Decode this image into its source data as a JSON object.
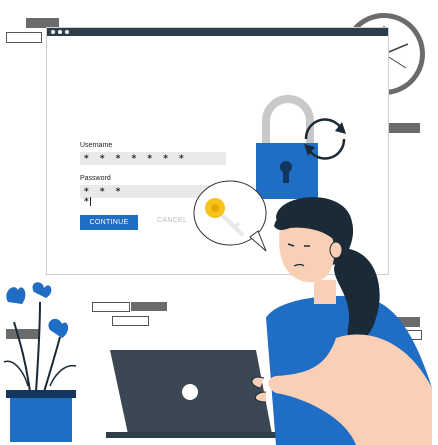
{
  "login": {
    "username_label": "Username",
    "username_value": "* * * * * * *",
    "password_label": "Password",
    "password_value": "* * * *",
    "continue_label": "CONTINUE",
    "cancel_label": "CANCEL"
  },
  "colors": {
    "accent": "#1f6dc4",
    "titlebar": "#2f3d4a",
    "lock": "#1f6dc4",
    "key": "#f7c21a",
    "skin": "#f9d0b5",
    "hair": "#1a2a36",
    "laptop": "#3b4753"
  },
  "icons": [
    "padlock-icon",
    "refresh-icon",
    "key-icon",
    "clock-icon",
    "laptop-icon"
  ]
}
